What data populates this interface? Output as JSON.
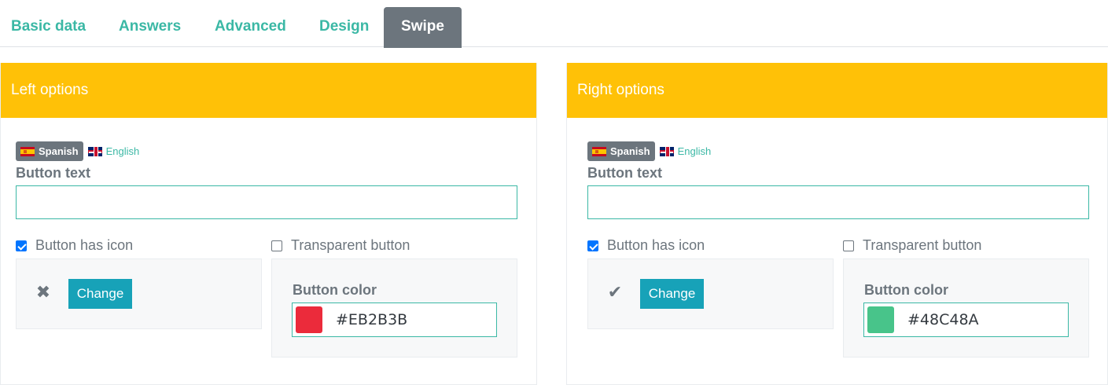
{
  "tabs": [
    {
      "label": "Basic data",
      "active": false
    },
    {
      "label": "Answers",
      "active": false
    },
    {
      "label": "Advanced",
      "active": false
    },
    {
      "label": "Design",
      "active": false
    },
    {
      "label": "Swipe",
      "active": true
    }
  ],
  "languages": [
    "Spanish",
    "English"
  ],
  "left": {
    "header": "Left options",
    "button_text_label": "Button text",
    "button_text_value": "",
    "has_icon_label": "Button has icon",
    "has_icon_checked": true,
    "transparent_label": "Transparent button",
    "transparent_checked": false,
    "icon": "close-icon",
    "icon_glyph": "✖",
    "change_label": "Change",
    "color_label": "Button color",
    "color_value": "#EB2B3B",
    "color_hex": "#eb2b3b"
  },
  "right": {
    "header": "Right options",
    "button_text_label": "Button text",
    "button_text_value": "",
    "has_icon_label": "Button has icon",
    "has_icon_checked": true,
    "transparent_label": "Transparent button",
    "transparent_checked": false,
    "icon": "checkmark-icon",
    "icon_glyph": "✔",
    "change_label": "Change",
    "color_label": "Button color",
    "color_value": "#48C48A",
    "color_hex": "#48c48a"
  }
}
